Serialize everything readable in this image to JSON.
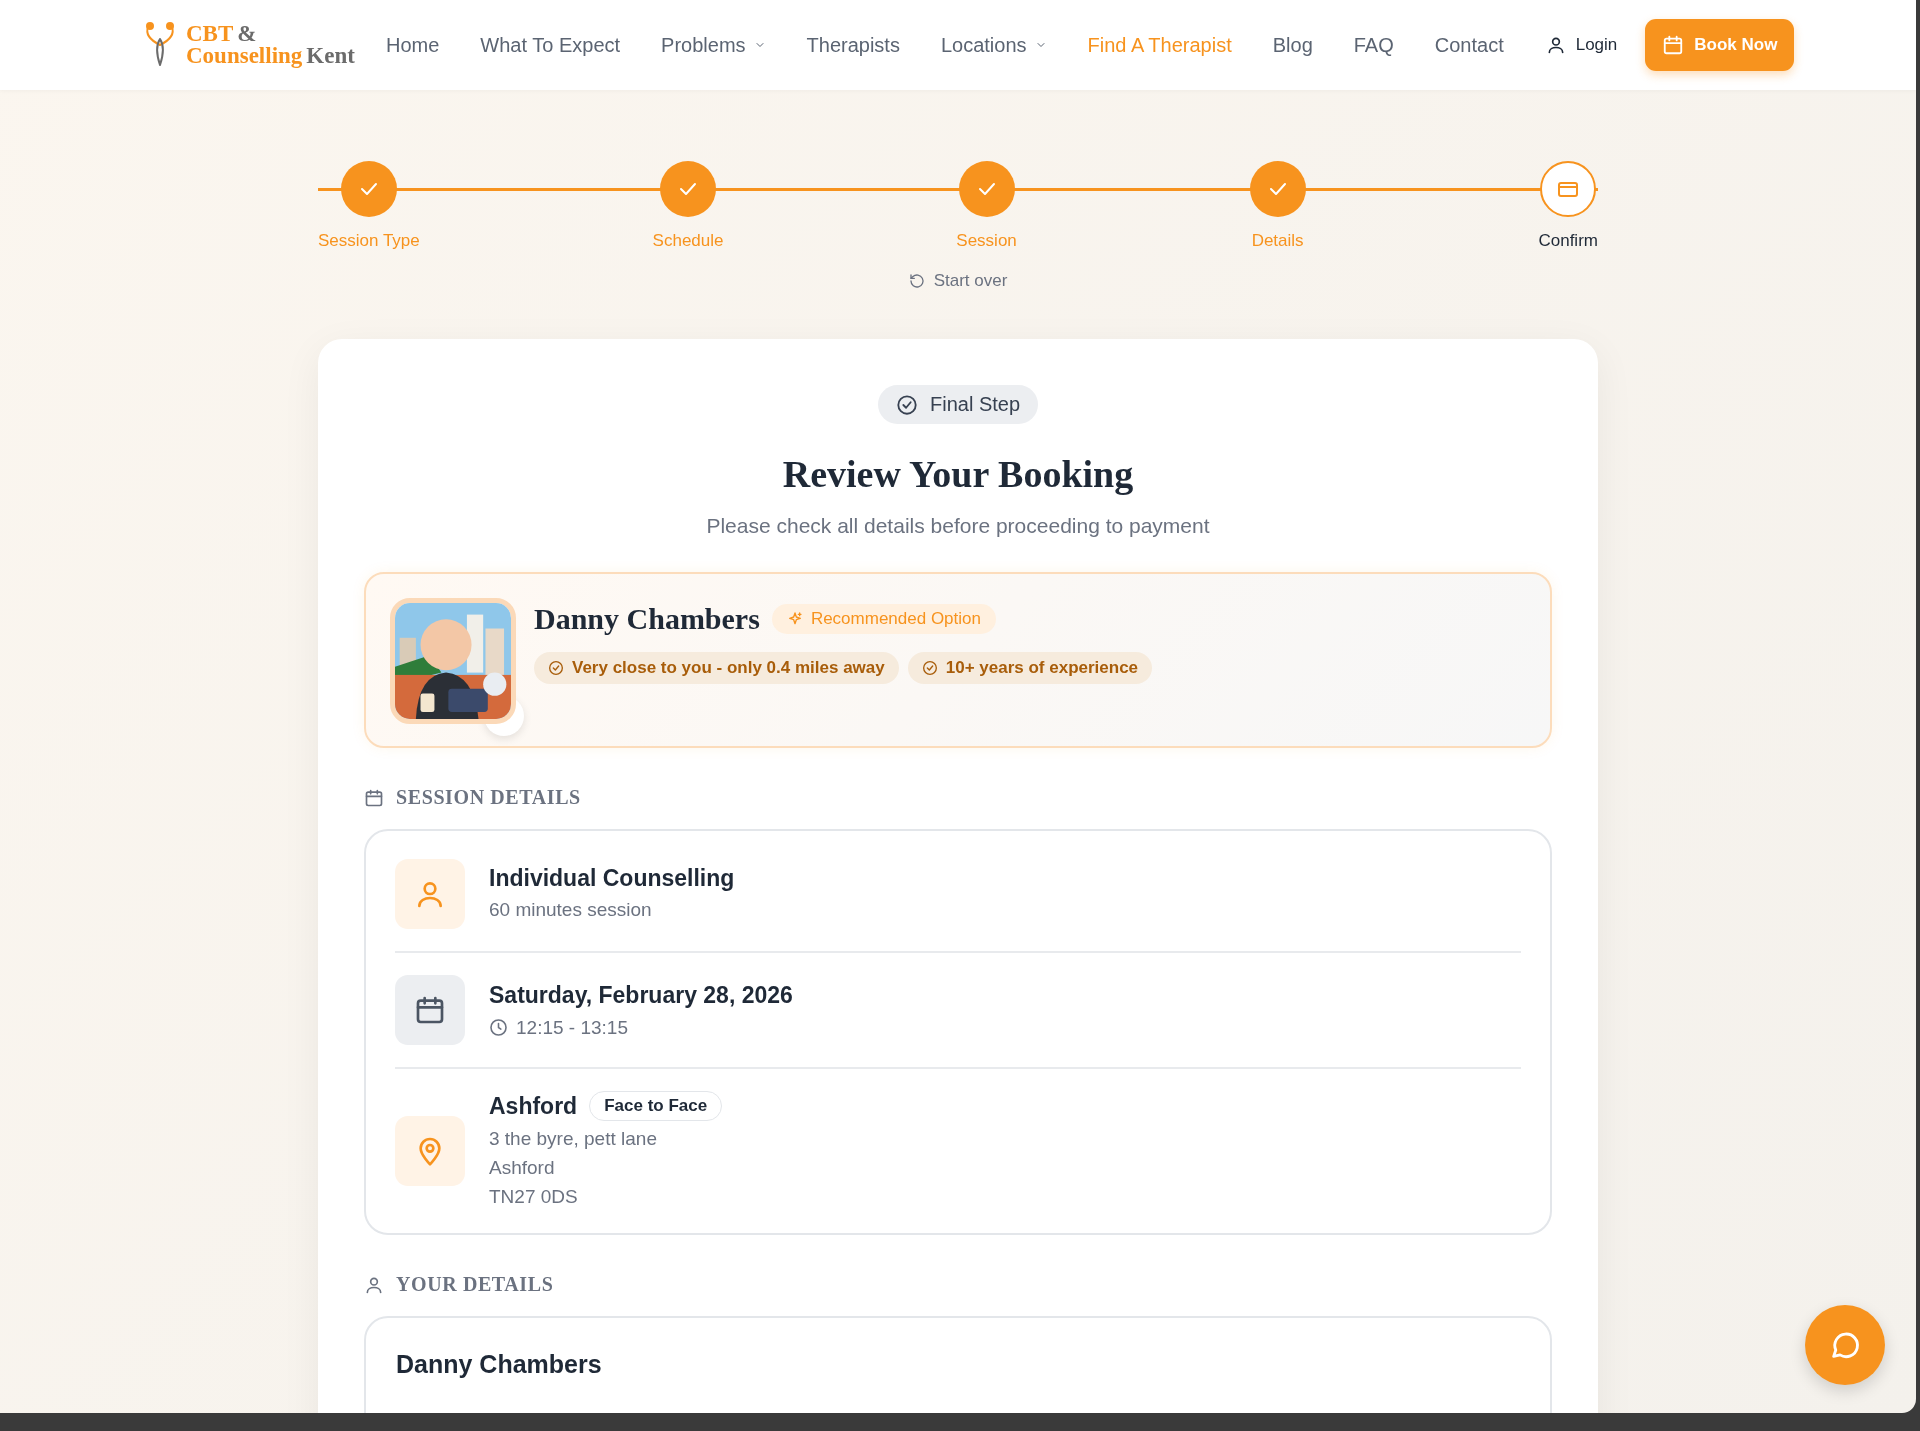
{
  "header": {
    "logo": [
      [
        {
          "text": "CBT",
          "accent": true
        },
        {
          "text": "&",
          "accent": false
        }
      ],
      [
        {
          "text": "Counselling",
          "accent": true
        },
        {
          "text": "Kent",
          "accent": false
        }
      ]
    ],
    "nav": [
      {
        "label": "Home",
        "dropdown": false,
        "selected": false
      },
      {
        "label": "What To Expect",
        "dropdown": false,
        "selected": false
      },
      {
        "label": "Problems",
        "dropdown": true,
        "selected": false
      },
      {
        "label": "Therapists",
        "dropdown": false,
        "selected": false
      },
      {
        "label": "Locations",
        "dropdown": true,
        "selected": false
      },
      {
        "label": "Find A Therapist",
        "dropdown": false,
        "selected": true
      },
      {
        "label": "Blog",
        "dropdown": false,
        "selected": false
      },
      {
        "label": "FAQ",
        "dropdown": false,
        "selected": false
      },
      {
        "label": "Contact",
        "dropdown": false,
        "selected": false
      }
    ],
    "login": "Login",
    "book_button": "Book Now"
  },
  "steps": [
    {
      "label": "Session Type",
      "completed": true,
      "selected": false
    },
    {
      "label": "Schedule",
      "completed": true,
      "selected": false
    },
    {
      "label": "Session",
      "completed": true,
      "selected": false
    },
    {
      "label": "Details",
      "completed": true,
      "selected": false
    },
    {
      "label": "Confirm",
      "completed": false,
      "selected": true
    }
  ],
  "start_over": "Start over",
  "review": {
    "badge": "Final Step",
    "title": "Review Your Booking",
    "subtitle": "Please check all details before proceeding to payment",
    "therapist": {
      "name": "Danny Chambers",
      "badge": "Recommended Option",
      "tags": [
        "Very close to you - only 0.4 miles away",
        "10+ years of experience"
      ]
    },
    "session_details": {
      "heading": "SESSION DETAILS",
      "items": [
        {
          "kind": "service",
          "title": "Individual Counselling",
          "subtitle": "60 minutes session"
        },
        {
          "kind": "date",
          "title": "Saturday, February 28, 2026",
          "time": "12:15 - 13:15"
        },
        {
          "kind": "location",
          "title": "Ashford",
          "tag": "Face to Face",
          "lines": [
            "3 the byre, pett lane",
            "Ashford",
            "TN27 0DS"
          ]
        }
      ]
    },
    "your_details": {
      "heading": "YOUR DETAILS",
      "name": "Danny Chambers"
    }
  }
}
